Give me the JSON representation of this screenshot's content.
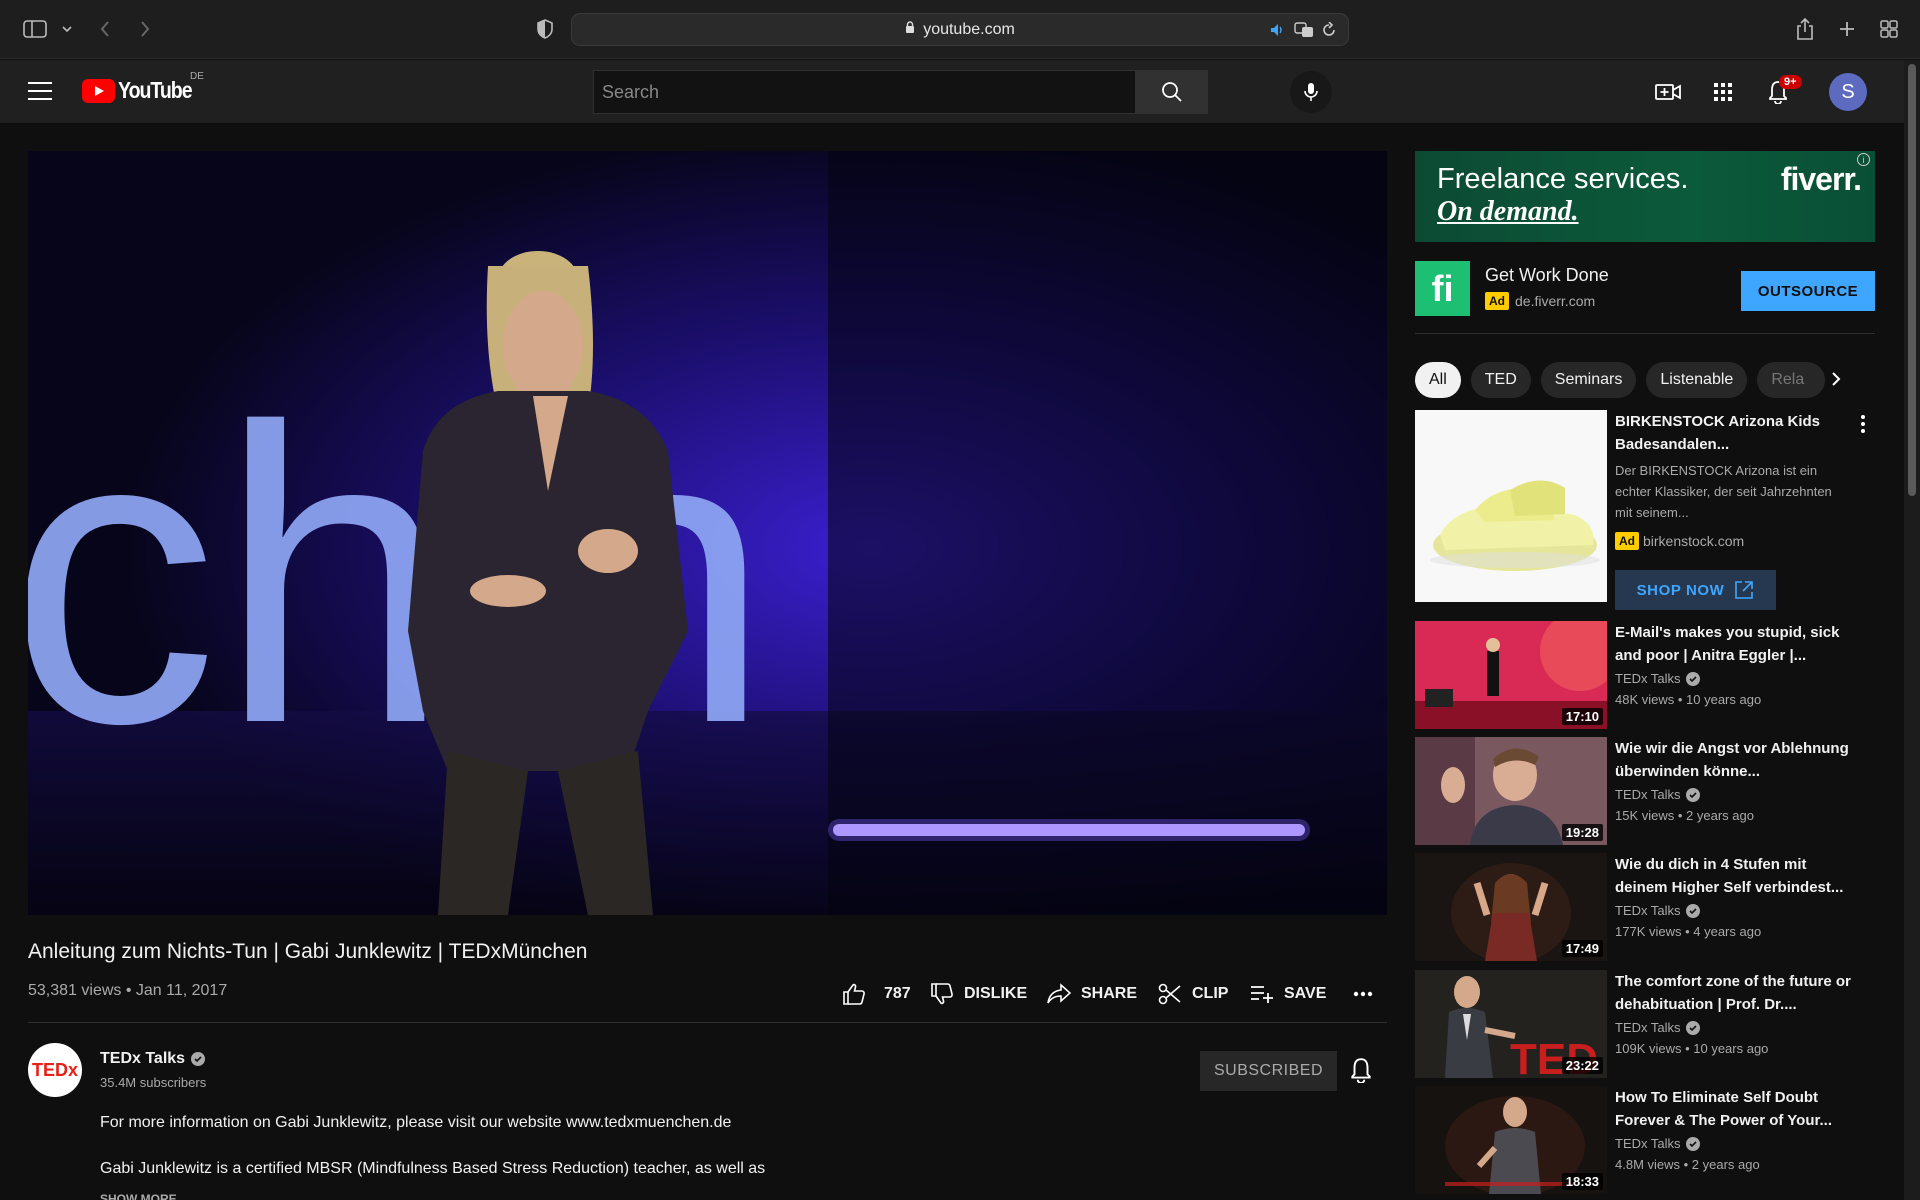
{
  "browser": {
    "url": "youtube.com"
  },
  "header": {
    "logo_text": "YouTube",
    "country_code": "DE",
    "search_placeholder": "Search",
    "notif_count": "9+",
    "avatar_letter": "S"
  },
  "video": {
    "title": "Anleitung zum Nichts-Tun | Gabi Junklewitz | TEDxMünchen",
    "views_date": "53,381 views • Jan 11, 2017",
    "likes": "787",
    "dislike_label": "DISLIKE",
    "share_label": "SHARE",
    "clip_label": "CLIP",
    "save_label": "SAVE"
  },
  "channel": {
    "name": "TEDx Talks",
    "subscribers": "35.4M subscribers",
    "subscribed_label": "SUBSCRIBED",
    "avatar_text": "TEDx"
  },
  "description": {
    "line1": "For more information on Gabi Junklewitz, please visit our website www.tedxmuenchen.de",
    "line2": "Gabi Junklewitz is a certified MBSR (Mindfulness Based Stress Reduction) teacher, as well as",
    "show_more": "SHOW MORE"
  },
  "ad_banner": {
    "line1": "Freelance services.",
    "line2": "On demand.",
    "brand": "fiverr."
  },
  "ad_card": {
    "title": "Get Work Done",
    "ad_label": "Ad",
    "domain": "de.fiverr.com",
    "cta": "OUTSOURCE"
  },
  "chips": [
    "All",
    "TED",
    "Seminars",
    "Listenable",
    "Rela"
  ],
  "promo": {
    "title": "BIRKENSTOCK Arizona Kids Badesandalen...",
    "description": "Der BIRKENSTOCK Arizona ist ein echter Klassiker, der seit Jahrzehnten mit seinem...",
    "ad_label": "Ad",
    "domain": "birkenstock.com",
    "cta": "SHOP NOW"
  },
  "recommendations": [
    {
      "title": "E-Mail's makes you stupid, sick and poor | Anitra Eggler |...",
      "channel": "TEDx Talks",
      "meta": "48K views • 10 years ago",
      "duration": "17:10"
    },
    {
      "title": "Wie wir die Angst vor Ablehnung überwinden könne...",
      "channel": "TEDx Talks",
      "meta": "15K views • 2 years ago",
      "duration": "19:28"
    },
    {
      "title": "Wie du dich in 4 Stufen mit deinem Higher Self verbindest...",
      "channel": "TEDx Talks",
      "meta": "177K views • 4 years ago",
      "duration": "17:49"
    },
    {
      "title": "The comfort zone of the future or dehabituation | Prof. Dr....",
      "channel": "TEDx Talks",
      "meta": "109K views • 10 years ago",
      "duration": "23:22"
    },
    {
      "title": "How To Eliminate Self Doubt Forever & The Power of Your...",
      "channel": "TEDx Talks",
      "meta": "4.8M views • 2 years ago",
      "duration": "18:33"
    }
  ]
}
